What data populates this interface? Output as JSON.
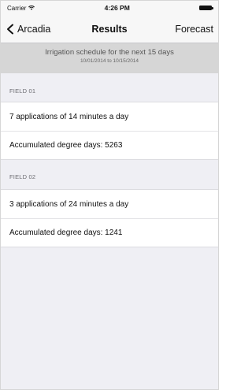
{
  "status_bar": {
    "carrier": "Carrier",
    "time": "4:26 PM"
  },
  "nav_bar": {
    "back_label": "Arcadia",
    "title": "Results",
    "right_label": "Forecast"
  },
  "banner": {
    "title": "Irrigation schedule for the next 15 days",
    "date_range": "10/01/2014 to 10/15/2014"
  },
  "fields": [
    {
      "header": "FIELD 01",
      "rows": [
        "7 applications of 14 minutes a day",
        "Accumulated degree days: 5263"
      ]
    },
    {
      "header": "FIELD 02",
      "rows": [
        "3 applications of 24 minutes a day",
        "Accumulated degree days: 1241"
      ]
    }
  ]
}
